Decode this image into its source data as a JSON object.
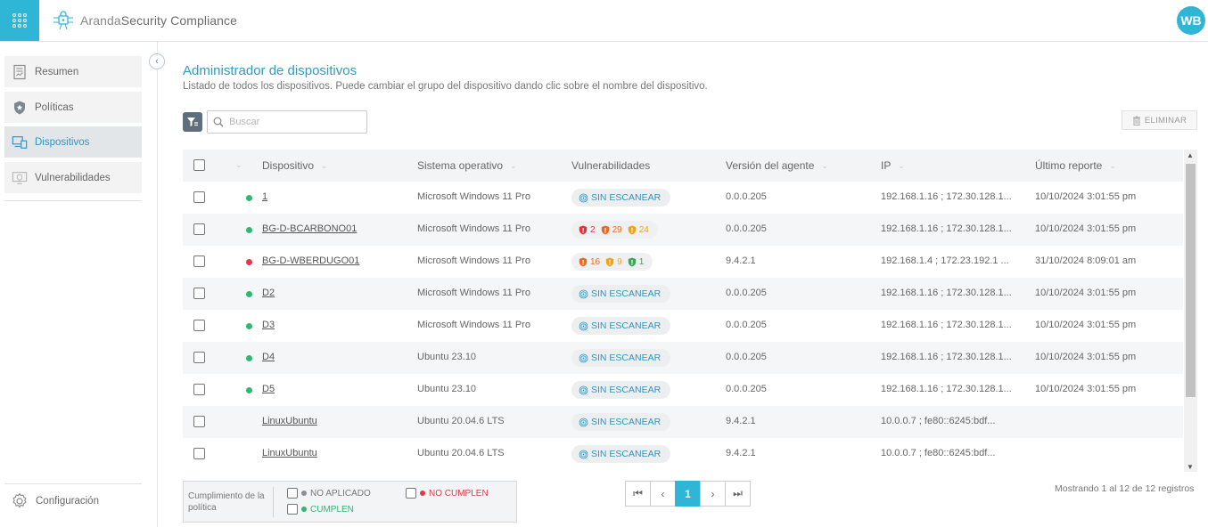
{
  "header": {
    "brand_prefix": "Aranda",
    "brand_name": "Security Compliance",
    "user_initials": "WB"
  },
  "sidebar": {
    "items": [
      {
        "label": "Resumen",
        "icon": "report-icon"
      },
      {
        "label": "Políticas",
        "icon": "shield-star-icon"
      },
      {
        "label": "Dispositivos",
        "icon": "devices-icon",
        "active": true
      },
      {
        "label": "Vulnerabilidades",
        "icon": "monitor-shield-icon"
      }
    ],
    "config_label": "Configuración"
  },
  "main": {
    "title": "Administrador de dispositivos",
    "subtitle": "Listado de todos los dispositivos. Puede cambiar el grupo del dispositivo dando clic sobre el nombre del dispositivo.",
    "search_placeholder": "Buscar",
    "delete_label": "ELIMINAR"
  },
  "table": {
    "columns": {
      "device": "Dispositivo",
      "os": "Sistema operativo",
      "vulns": "Vulnerabilidades",
      "agent": "Versión del agente",
      "ip": "IP",
      "last_report": "Último reporte"
    },
    "rows": [
      {
        "status": "#2eb872",
        "device": "1",
        "os": "Microsoft Windows 11 Pro",
        "vuln_text": "SIN ESCANEAR",
        "agent": "0.0.0.205",
        "ip": "192.168.1.16 ; 172.30.128.1...",
        "last": "10/10/2024 3:01:55 pm"
      },
      {
        "status": "#2eb872",
        "device": "BG-D-BCARBONO01",
        "os": "Microsoft Windows 11 Pro",
        "vuln_counts": [
          {
            "n": "2",
            "color": "#d9363e"
          },
          {
            "n": "29",
            "color": "#ec6a1f"
          },
          {
            "n": "24",
            "color": "#f2a31b"
          }
        ],
        "agent": "0.0.0.205",
        "ip": "192.168.1.16 ; 172.30.128.1...",
        "last": "10/10/2024 3:01:55 pm"
      },
      {
        "status": "#e0394a",
        "device": "BG-D-WBERDUGO01",
        "os": "Microsoft Windows 11 Pro",
        "vuln_counts": [
          {
            "n": "16",
            "color": "#ec6a1f"
          },
          {
            "n": "9",
            "color": "#f2a31b"
          },
          {
            "n": "1",
            "color": "#3aa855"
          }
        ],
        "agent": "9.4.2.1",
        "ip": "192.168.1.4 ; 172.23.192.1 ...",
        "last": "31/10/2024 8:09:01 am"
      },
      {
        "status": "#2eb872",
        "device": "D2",
        "os": "Microsoft Windows 11 Pro",
        "vuln_text": "SIN ESCANEAR",
        "agent": "0.0.0.205",
        "ip": "192.168.1.16 ; 172.30.128.1...",
        "last": "10/10/2024 3:01:55 pm"
      },
      {
        "status": "#2eb872",
        "device": "D3",
        "os": "Microsoft Windows 11 Pro",
        "vuln_text": "SIN ESCANEAR",
        "agent": "0.0.0.205",
        "ip": "192.168.1.16 ; 172.30.128.1...",
        "last": "10/10/2024 3:01:55 pm"
      },
      {
        "status": "#2eb872",
        "device": "D4",
        "os": "Ubuntu 23.10",
        "vuln_text": "SIN ESCANEAR",
        "agent": "0.0.0.205",
        "ip": "192.168.1.16 ; 172.30.128.1...",
        "last": "10/10/2024 3:01:55 pm"
      },
      {
        "status": "#2eb872",
        "device": "D5",
        "os": "Ubuntu 23.10",
        "vuln_text": "SIN ESCANEAR",
        "agent": "0.0.0.205",
        "ip": "192.168.1.16 ; 172.30.128.1...",
        "last": "10/10/2024 3:01:55 pm"
      },
      {
        "status": "",
        "device": "LinuxUbuntu",
        "os": "Ubuntu 20.04.6 LTS",
        "vuln_text": "SIN ESCANEAR",
        "agent": "9.4.2.1",
        "ip": "10.0.0.7 ; fe80::6245:bdf...",
        "last": ""
      },
      {
        "status": "",
        "device": "LinuxUbuntu",
        "os": "Ubuntu 20.04.6 LTS",
        "vuln_text": "SIN ESCANEAR",
        "agent": "9.4.2.1",
        "ip": "10.0.0.7 ; fe80::6245:bdf...",
        "last": ""
      }
    ]
  },
  "legend": {
    "title": "Cumplimiento de la política",
    "items": [
      {
        "label": "NO APLICADO",
        "color": "#8a8f94",
        "text_color": "#777777"
      },
      {
        "label": "NO CUMPLEN",
        "color": "#e0394a",
        "text_color": "#e0394a"
      },
      {
        "label": "CUMPLEN",
        "color": "#2eb872",
        "text_color": "#2eb872"
      }
    ]
  },
  "pagination": {
    "current_page": "1",
    "records_text": "Mostrando 1 al 12 de 12 registros"
  },
  "colors": {
    "accent": "#2fb5d6",
    "link_title": "#2e9bc6"
  }
}
